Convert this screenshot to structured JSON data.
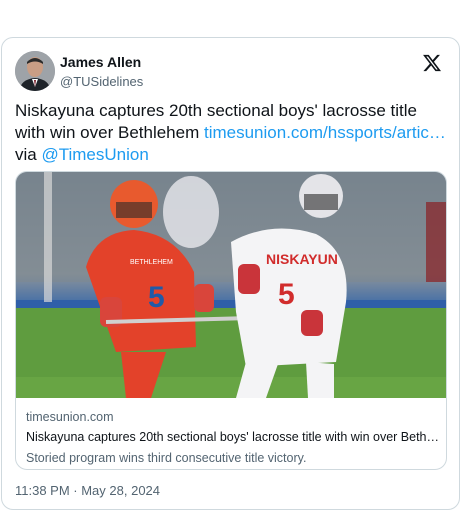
{
  "author": {
    "name": "James Allen",
    "handle": "@TUSidelines"
  },
  "tweet": {
    "text": "Niskayuna captures 20th sectional boys' lacrosse title with win over Bethlehem ",
    "link_text": "timesunion.com/hssports/artic…",
    "via_text": " via ",
    "mention": "@TimesUnion"
  },
  "card": {
    "domain": "timesunion.com",
    "title": "Niskayuna captures 20th sectional boys' lacrosse title with win over Beth…",
    "description": "Storied program wins third consecutive title victory.",
    "photo": {
      "jersey_left_number": "5",
      "jersey_left_text": "BETHLEHEM",
      "jersey_right_number": "5",
      "jersey_right_text": "NISKAYUN"
    }
  },
  "timestamp": "11:38 PM · May 28, 2024",
  "icons": {
    "platform_logo": "x-logo-icon"
  },
  "colors": {
    "link": "#1d9bf0",
    "text": "#0f1419",
    "secondary": "#536471",
    "border": "#cfd9de"
  }
}
